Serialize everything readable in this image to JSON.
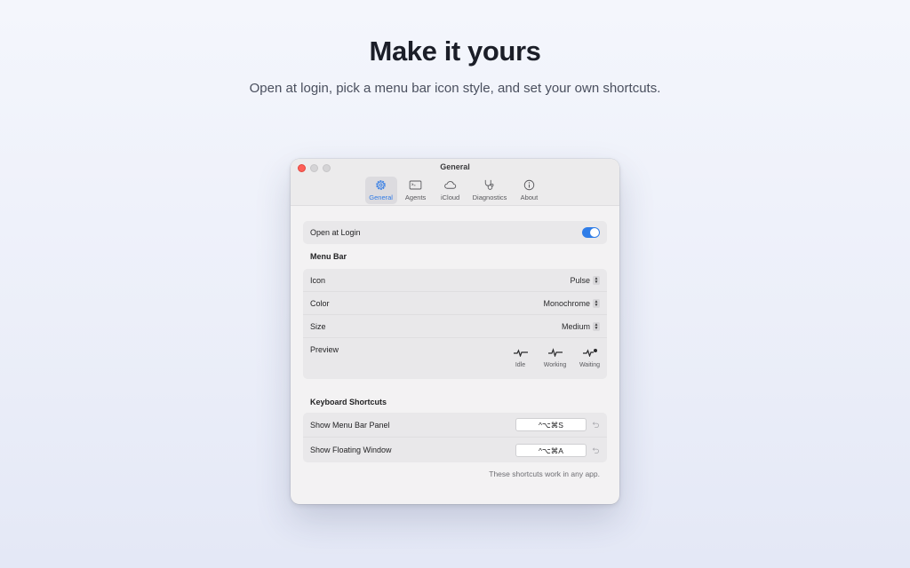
{
  "hero": {
    "title": "Make it yours",
    "subtitle": "Open at login, pick a menu bar icon style, and set your own shortcuts."
  },
  "window": {
    "title": "General",
    "tabs": [
      {
        "label": "General",
        "icon": "gear-icon",
        "active": true
      },
      {
        "label": "Agents",
        "icon": "terminal-icon",
        "active": false
      },
      {
        "label": "iCloud",
        "icon": "cloud-icon",
        "active": false
      },
      {
        "label": "Diagnostics",
        "icon": "stethoscope-icon",
        "active": false
      },
      {
        "label": "About",
        "icon": "info-icon",
        "active": false
      }
    ]
  },
  "general": {
    "open_at_login": {
      "label": "Open at Login",
      "enabled": true
    }
  },
  "menu_bar": {
    "section_title": "Menu Bar",
    "icon": {
      "label": "Icon",
      "value": "Pulse"
    },
    "color": {
      "label": "Color",
      "value": "Monochrome"
    },
    "size": {
      "label": "Size",
      "value": "Medium"
    },
    "preview": {
      "label": "Preview",
      "states": [
        {
          "label": "Idle",
          "icon": "pulse-idle-icon"
        },
        {
          "label": "Working",
          "icon": "pulse-working-icon"
        },
        {
          "label": "Waiting",
          "icon": "pulse-waiting-icon"
        }
      ]
    }
  },
  "shortcuts": {
    "section_title": "Keyboard Shortcuts",
    "items": [
      {
        "label": "Show Menu Bar Panel",
        "keys": "^⌥⌘S"
      },
      {
        "label": "Show Floating Window",
        "keys": "^⌥⌘A"
      }
    ],
    "footnote": "These shortcuts work in any app."
  },
  "colors": {
    "accent": "#2f7ae5",
    "close": "#fe5f57"
  }
}
